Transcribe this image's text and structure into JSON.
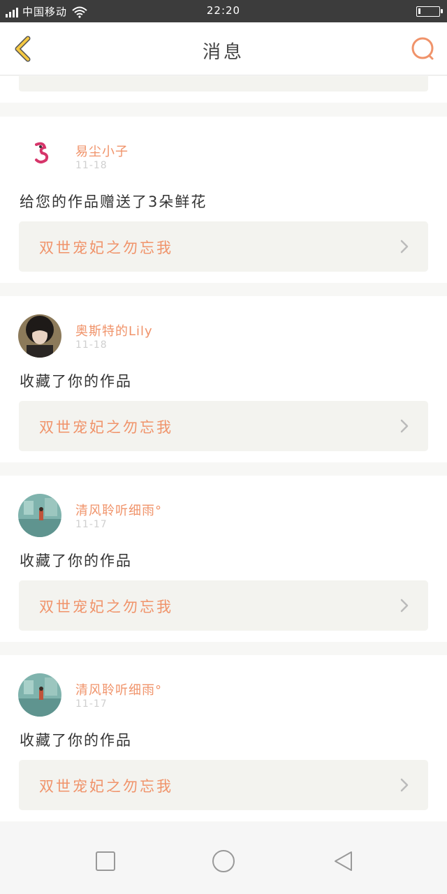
{
  "status_bar": {
    "carrier": "中国移动",
    "time": "22:20",
    "battery_level": 0.1
  },
  "header": {
    "title": "消息",
    "back_icon": "chevron-left-icon",
    "search_icon": "search-icon"
  },
  "messages": [
    {
      "username": "易尘小子",
      "date": "11-18",
      "text": "给您的作品赠送了3朵鲜花",
      "work_title": "双世宠妃之勿忘我"
    },
    {
      "username": "奥斯特的Lily",
      "date": "11-18",
      "text": "收藏了你的作品",
      "work_title": "双世宠妃之勿忘我"
    },
    {
      "username": "清风聆听细雨°",
      "date": "11-17",
      "text": "收藏了你的作品",
      "work_title": "双世宠妃之勿忘我"
    },
    {
      "username": "清风聆听细雨°",
      "date": "11-17",
      "text": "收藏了你的作品",
      "work_title": "双世宠妃之勿忘我"
    }
  ],
  "colors": {
    "accent": "#f0936a",
    "back_icon": "#f5c842",
    "link_bg": "#f3f3ef"
  }
}
